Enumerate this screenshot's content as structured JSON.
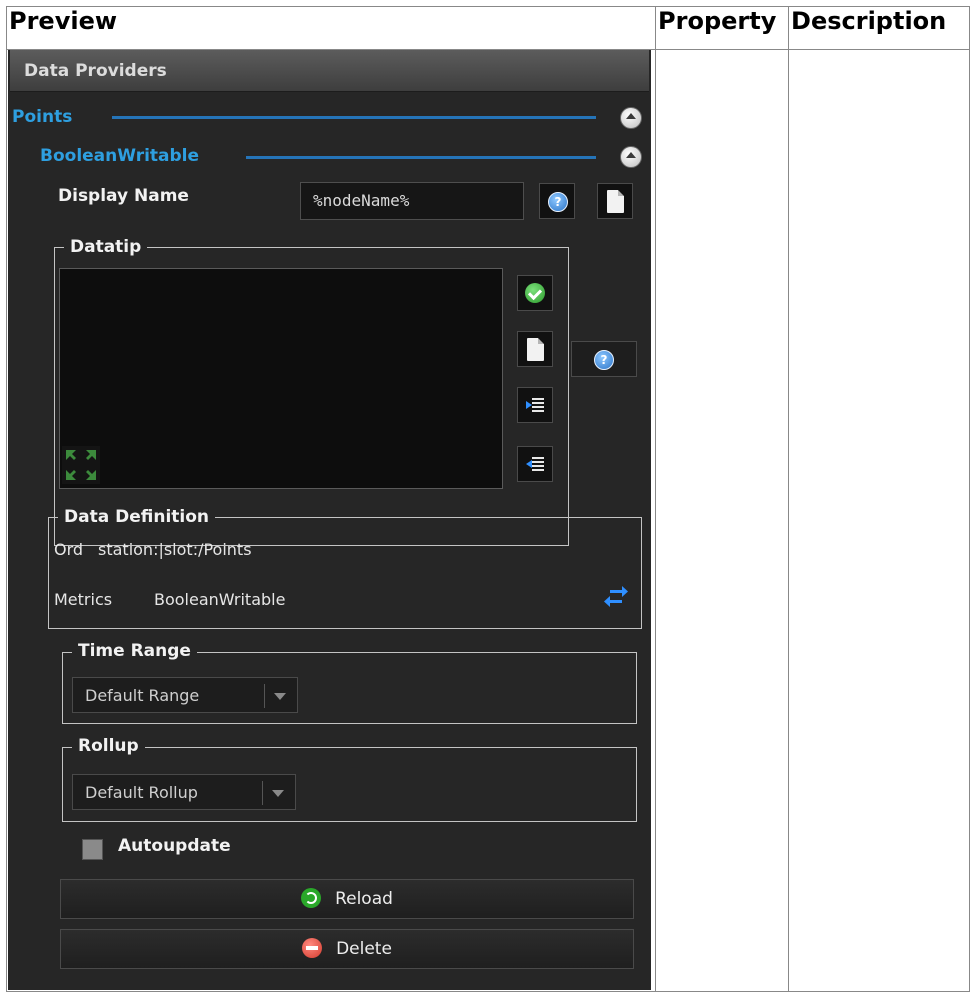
{
  "table": {
    "col_preview": "Preview",
    "col_property": "Property",
    "col_description": "Description"
  },
  "panel": {
    "title": "Data Providers",
    "points_section": "Points",
    "item_section": "BooleanWritable",
    "display_name_label": "Display Name",
    "display_name_value": "%nodeName%",
    "datatip_legend": "Datatip",
    "data_definition_legend": "Data Definition",
    "ord_label": "Ord",
    "ord_value": "station:|slot:/Points",
    "metrics_label": "Metrics",
    "metrics_value": "BooleanWritable",
    "time_range_legend": "Time Range",
    "time_range_value": "Default Range",
    "rollup_legend": "Rollup",
    "rollup_value": "Default Rollup",
    "autoupdate_label": "Autoupdate",
    "autoupdate_checked": false,
    "reload_label": "Reload",
    "delete_label": "Delete",
    "help_glyph": "?"
  },
  "colors": {
    "section_blue": "#2e9fe0",
    "panel_bg": "#262626"
  }
}
